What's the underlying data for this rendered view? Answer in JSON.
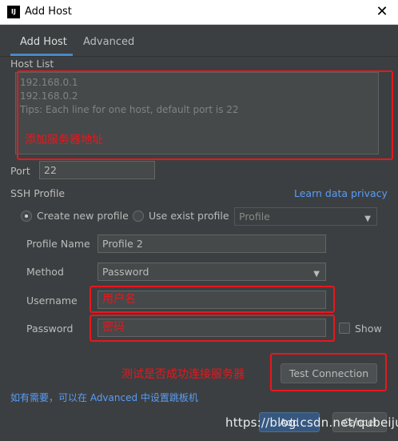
{
  "window": {
    "title": "Add Host",
    "app_icon_text": "IJ",
    "close_glyph": "✕"
  },
  "tabs": [
    {
      "label": "Add Host",
      "active": true
    },
    {
      "label": "Advanced",
      "active": false
    }
  ],
  "host_list": {
    "label": "Host List",
    "lines": [
      "192.168.0.1",
      "192.168.0.2",
      "Tips: Each line for one host, default port is 22"
    ],
    "annotation": "添加服务器地址"
  },
  "port": {
    "label": "Port",
    "value": "22"
  },
  "ssh_profile": {
    "label": "SSH Profile",
    "link": "Learn data privacy",
    "create_new_label": "Create new profile",
    "use_exist_label": "Use exist profile",
    "profile_select_value": "Profile",
    "profile_name_label": "Profile Name",
    "profile_name_value": "Profile 2",
    "method_label": "Method",
    "method_value": "Password",
    "username_label": "Username",
    "username_value": "用户名",
    "password_label": "Password",
    "password_value": "密码",
    "show_label": "Show"
  },
  "test": {
    "annotation": "测试是否成功连接服务器",
    "button_label": "Test Connection"
  },
  "hint": "如有需要，可以在 Advanced 中设置跳板机",
  "footer": {
    "add_label": "Add",
    "cancel_label": "Cancel"
  },
  "watermark": "https://blog.csdn.net/qubeijun",
  "colors": {
    "accent": "#4a88c7",
    "annotation_red": "#e8171d",
    "link": "#589df6",
    "background": "#3c3f41"
  }
}
